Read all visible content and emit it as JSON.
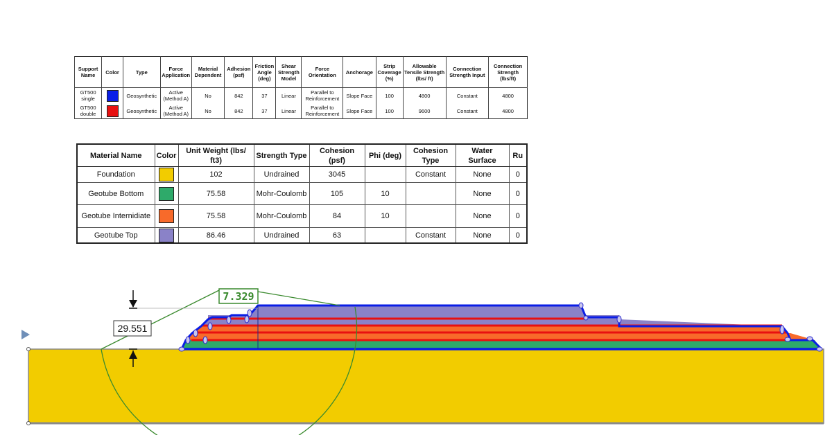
{
  "support_table": {
    "headers": [
      "Support Name",
      "Color",
      "Type",
      "Force Application",
      "Material Dependent",
      "Adhesion (psf)",
      "Friction Angle (deg)",
      "Shear Strength Model",
      "Force Orientation",
      "Anchorage",
      "Strip Coverage (%)",
      "Allowable Tensile Strength (lbs/ ft)",
      "Connection Strength Input",
      "Connection Strength (lbs/ft)"
    ],
    "rows": [
      {
        "name": "GT500 single",
        "color": "#0a1ee6",
        "type": "Geosynthetic",
        "force_application": "Active (Method A)",
        "material_dependent": "No",
        "adhesion": "842",
        "friction_angle": "37",
        "shear_model": "Linear",
        "force_orientation": "Parallel to Reinforcement",
        "anchorage": "Slope Face",
        "strip_coverage": "100",
        "tensile_strength": "4800",
        "conn_input": "Constant",
        "conn_strength": "4800"
      },
      {
        "name": "GT500 double",
        "color": "#e81010",
        "type": "Geosynthetic",
        "force_application": "Active (Method A)",
        "material_dependent": "No",
        "adhesion": "842",
        "friction_angle": "37",
        "shear_model": "Linear",
        "force_orientation": "Parallel to Reinforcement",
        "anchorage": "Slope Face",
        "strip_coverage": "100",
        "tensile_strength": "9600",
        "conn_input": "Constant",
        "conn_strength": "4800"
      }
    ]
  },
  "material_table": {
    "headers": [
      "Material Name",
      "Color",
      "Unit Weight (lbs/ ft3)",
      "Strength Type",
      "Cohesion (psf)",
      "Phi (deg)",
      "Cohesion Type",
      "Water Surface",
      "Ru"
    ],
    "rows": [
      {
        "name": "Foundation",
        "color": "#f2cc00",
        "unit_weight": "102",
        "strength_type": "Undrained",
        "cohesion": "3045",
        "phi": "",
        "cohesion_type": "Constant",
        "water_surface": "None",
        "ru": "0"
      },
      {
        "name": "Geotube Bottom",
        "color": "#2eaa6a",
        "unit_weight": "75.58",
        "strength_type": "Mohr-Coulomb",
        "cohesion": "105",
        "phi": "10",
        "cohesion_type": "",
        "water_surface": "None",
        "ru": "0"
      },
      {
        "name": "Geotube Internidiate",
        "color": "#f86a2a",
        "unit_weight": "75.58",
        "strength_type": "Mohr-Coulomb",
        "cohesion": "84",
        "phi": "10",
        "cohesion_type": "",
        "water_surface": "None",
        "ru": "0"
      },
      {
        "name": "Geotube Top",
        "color": "#8a82c8",
        "unit_weight": "86.46",
        "strength_type": "Undrained",
        "cohesion": "63",
        "phi": "",
        "cohesion_type": "Constant",
        "water_surface": "None",
        "ru": "0"
      }
    ]
  },
  "model": {
    "factor_of_safety": "7.329",
    "dimension_label": "29.551",
    "colors": {
      "foundation": "#f2cc00",
      "geotube_bottom": "#2eaa6a",
      "geotube_intermediate": "#f86a2a",
      "geotube_top": "#8a82c8",
      "gt500_single": "#0a1ee6",
      "gt500_double": "#e81010",
      "slip_surface": "#3a8a2e"
    }
  }
}
